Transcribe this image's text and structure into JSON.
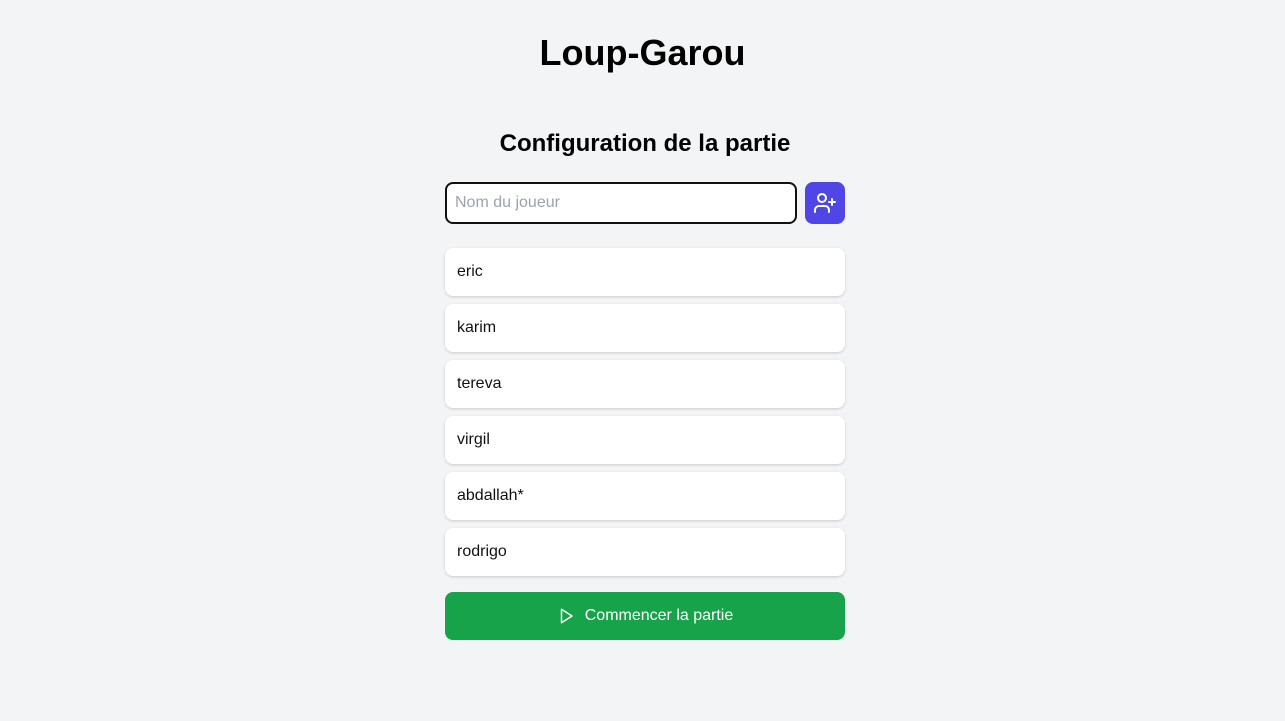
{
  "app": {
    "title": "Loup-Garou"
  },
  "setup": {
    "title": "Configuration de la partie",
    "name_input": {
      "placeholder": "Nom du joueur",
      "value": ""
    },
    "add_player_icon": "user-plus-icon",
    "players": [
      "eric",
      "karim",
      "tereva",
      "virgil",
      "abdallah*",
      "rodrigo"
    ],
    "start_button": {
      "label": "Commencer la partie",
      "icon": "play-icon"
    }
  },
  "colors": {
    "background": "#f3f4f6",
    "accent": "#4f46e5",
    "start": "#16a34a"
  }
}
